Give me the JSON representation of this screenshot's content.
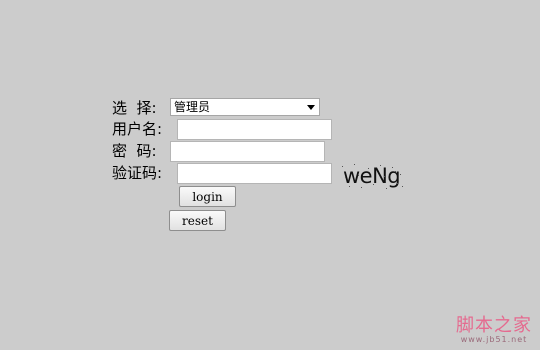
{
  "form": {
    "role_label": "选  择:",
    "role_value": "管理员",
    "username_label": "用户名:",
    "username_value": "",
    "password_label": "密  码:",
    "password_value": "",
    "captcha_label": "验证码:",
    "captcha_value": "",
    "captcha_text": "weNg",
    "login_label": "login",
    "reset_label": "reset"
  },
  "watermark": {
    "title": "脚本之家",
    "url": "www.jb51.net"
  },
  "colors": {
    "background": "#cccccc",
    "watermark": "#e56a8f"
  }
}
